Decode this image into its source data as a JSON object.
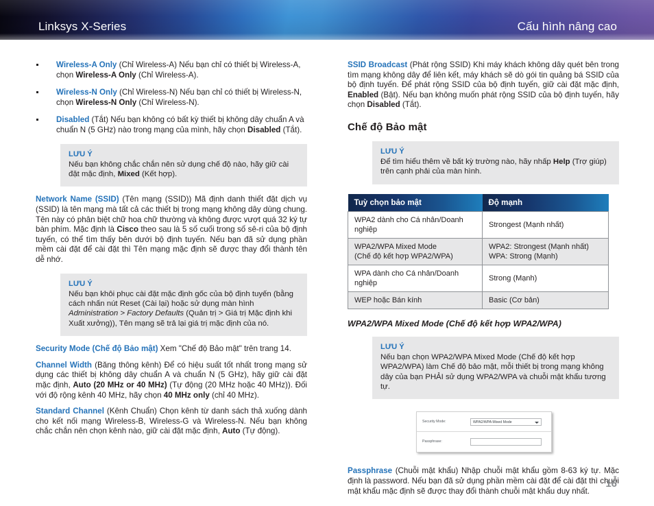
{
  "header": {
    "left_title": "Linksys X-Series",
    "right_title": "Cấu hình nâng cao"
  },
  "left_column": {
    "bullets": [
      {
        "term": "Wireless-A Only",
        "rest_a": " (Chỉ Wireless-A)  Nếu bạn chỉ có thiết bị Wireless-A, chọn ",
        "bold": "Wireless-A Only",
        "rest_b": " (Chỉ Wireless-A)."
      },
      {
        "term": "Wireless-N Only",
        "rest_a": " (Chỉ Wireless-N)  Nếu bạn chỉ có thiết bị Wireless-N, chọn ",
        "bold": "Wireless-N Only",
        "rest_b": " (Chỉ Wireless-N)."
      },
      {
        "term": "Disabled",
        "rest_a": " (Tắt)  Nếu bạn không có bất kỳ thiết bị không dây chuẩn A và chuẩn N (5 GHz) nào trong mạng của mình, hãy chọn ",
        "bold": "Disabled",
        "rest_b": " (Tắt)."
      }
    ],
    "note1": {
      "title": "LƯU Ý",
      "text_a": " Nếu bạn không chắc chắn nên sử dụng chế độ nào, hãy giữ cài đặt mặc định, ",
      "bold": "Mixed",
      "text_b": " (Kết hợp)."
    },
    "ssid_para": {
      "term": "Network Name (SSID)",
      "text_a": " (Tên mạng (SSID)) Mã định danh thiết đặt dịch vụ (SSID) là tên mạng mà tất cả các thiết bị trong mạng không dây dùng chung. Tên này có phân biệt chữ hoa chữ thường và không được vượt quá 32 ký tự bàn phím. Mặc định là ",
      "bold": "Cisco",
      "text_b": " theo sau là 5 số cuối trong số sê-ri của bộ định tuyến, có thể tìm thấy bên dưới bộ định tuyến. Nếu bạn đã sử dụng phần mềm cài đặt để cài đặt thì Tên mạng mặc định sẽ được thay đổi thành tên dễ nhớ."
    },
    "note2": {
      "title": "LƯU Ý",
      "text_a": "Nếu bạn khôi phục cài đặt mặc định gốc của bộ định tuyến (bằng cách nhấn nút Reset (Cài lại) hoặc sử dụng màn hình ",
      "italic": "Administration > Factory Defaults",
      "text_b": " (Quản trị > Giá trị Mặc định khi Xuất xưởng)), Tên mạng sẽ trả lại giá trị mặc định của nó."
    },
    "security_mode_para": {
      "term": "Security Mode (Chế độ Bảo mật)",
      "text": "  Xem \"Chế độ Bảo mật\" trên trang 14."
    },
    "channel_width_para": {
      "term": "Channel Width",
      "text_a": " (Băng thông kênh)  Để có hiệu suất tốt nhất trong mạng sử dụng các thiết bị không dây chuẩn A và chuẩn N (5 GHz), hãy giữ cài đặt mặc định, ",
      "bold_a": "Auto (20 MHz or 40 MHz)",
      "text_b": " (Tự động (20 MHz hoặc 40 MHz)). Đối với độ rộng kênh 40 MHz, hãy chọn ",
      "bold_b": "40 MHz only",
      "text_c": " (chỉ 40 MHz)."
    },
    "standard_channel_para": {
      "term": "Standard Channel",
      "text_a": " (Kênh Chuẩn)  Chọn kênh từ danh sách thả xuống dành cho kết nối mạng Wireless-B, Wireless-G và Wireless-N. Nếu bạn không chắc chắn nên chọn kênh nào, giữ cài đặt mặc định, ",
      "bold": "Auto",
      "text_b": " (Tự động)."
    }
  },
  "right_column": {
    "ssid_broadcast_para": {
      "term": "SSID Broadcast",
      "text_a": " (Phát rộng SSID)  Khi máy khách không dây quét bên trong tìm mạng không dây để liên kết, máy khách sẽ dò gói tin quảng bá SSID của bộ định tuyến. Để phát rộng SSID của bộ định tuyến, giữ cài đặt mặc định, ",
      "bold_a": "Enabled",
      "text_b": " (Bật). Nếu bạn không muốn phát rộng SSID của bộ định tuyến, hãy chọn ",
      "bold_b": "Disabled",
      "text_c": " (Tắt)."
    },
    "section_heading": "Chế độ Bảo mật",
    "note3": {
      "title": "LƯU Ý",
      "text_a": "Để tìm hiểu thêm về bất kỳ trường nào, hãy nhấp ",
      "bold": "Help",
      "text_b": " (Trợ giúp) trên cạnh phải của màn hình."
    },
    "table": {
      "headers": [
        "Tuỳ chọn bảo mật",
        "Độ mạnh"
      ],
      "rows": [
        {
          "option": "WPA2 dành cho Cá nhân/Doanh nghiệp",
          "strength": "Strongest (Mạnh nhất)"
        },
        {
          "option_line1": "WPA2/WPA Mixed Mode",
          "option_line2": "(Chế độ kết hợp WPA2/WPA)",
          "strength_line1": "WPA2: Strongest (Mạnh nhất)",
          "strength_line2": "WPA: Strong (Mạnh)"
        },
        {
          "option": "WPA dành cho Cá nhân/Doanh nghiệp",
          "strength": "Strong (Mạnh)"
        },
        {
          "option": "WEP hoặc Bán kính",
          "strength": "Basic (Cơ bản)"
        }
      ]
    },
    "subsection_heading": "WPA2/WPA Mixed Mode (Chế độ kết hợp WPA2/WPA)",
    "note4": {
      "title": "LƯU Ý",
      "text": "Nếu bạn chọn WPA2/WPA Mixed Mode (Chế độ kết hợp WPA2/WPA) làm Chế độ bảo mật, mỗi thiết bị trong mạng không dây của bạn PHẢI sử dụng WPA2/WPA và chuỗi mật khẩu tương tự."
    },
    "screenshot": {
      "security_mode_label": "Security Mode:",
      "security_mode_value": "WPA2/WPA Mixed Mode",
      "passphrase_label": "Passphrase:",
      "passphrase_value": ""
    },
    "passphrase_para": {
      "term": "Passphrase",
      "text": " (Chuỗi mật khẩu)  Nhập chuỗi mật khẩu gồm 8-63 ký tự. Mặc định là password. Nếu bạn đã sử dụng phần mềm cài đặt để cài đặt thì chuỗi mật khẩu mặc định sẽ được thay đổi thành chuỗi mật khẩu duy nhất."
    }
  },
  "footer": {
    "page_number": "16"
  },
  "colors": {
    "term_blue": "#2573b9",
    "note_bg": "#e7e7e8",
    "table_header_start": "#12284c",
    "table_header_end": "#1e7ebc",
    "page_number_gray": "#8a8d90"
  }
}
